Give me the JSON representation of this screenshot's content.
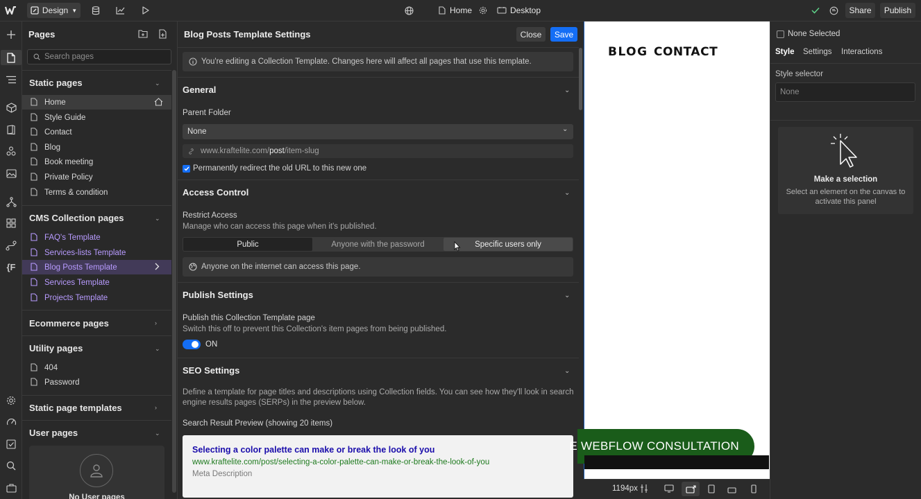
{
  "topbar": {
    "design_label": "Design",
    "page_label": "Home",
    "breakpoint_label": "Desktop",
    "share_label": "Share",
    "publish_label": "Publish"
  },
  "pages_panel": {
    "title": "Pages",
    "search_placeholder": "Search pages",
    "static": {
      "title": "Static pages",
      "items": [
        "Home",
        "Style Guide",
        "Contact",
        "Blog",
        "Book meeting",
        "Private Policy",
        "Terms & condition"
      ]
    },
    "cms": {
      "title": "CMS Collection pages",
      "items": [
        "FAQ's Template",
        "Services-lists Template",
        "Blog Posts Template",
        "Services Template",
        "Projects Template"
      ]
    },
    "ecommerce_title": "Ecommerce pages",
    "utility": {
      "title": "Utility pages",
      "items": [
        "404",
        "Password"
      ]
    },
    "static_templates_title": "Static page templates",
    "user_pages_title": "User pages",
    "no_user_pages": "No User pages"
  },
  "settings": {
    "title": "Blog Posts Template Settings",
    "close_label": "Close",
    "save_label": "Save",
    "notice": "You're editing a Collection Template. Changes here will affect all pages that use this template.",
    "general": {
      "title": "General",
      "parent_folder_label": "Parent Folder",
      "parent_folder_value": "None",
      "url_prefix": "www.kraftelite.com/",
      "url_bold": "post",
      "url_suffix": "/item-slug",
      "redirect_label": "Permanently redirect the old URL to this new one"
    },
    "access": {
      "title": "Access Control",
      "restrict_label": "Restrict Access",
      "restrict_sub": "Manage who can access this page when it's published.",
      "options": [
        "Public",
        "Anyone with the password",
        "Specific users only"
      ],
      "info": "Anyone on the internet can access this page."
    },
    "publish": {
      "title": "Publish Settings",
      "label": "Publish this Collection Template page",
      "sub": "Switch this off to prevent this Collection's item pages from being published.",
      "toggle_label": "ON"
    },
    "seo": {
      "title": "SEO Settings",
      "desc_line1": "Define a template for page titles and descriptions using Collection fields. You can see how they'll look in search",
      "desc_line2": "engine results pages (SERPs) in the preview below.",
      "preview_label": "Search Result Preview (showing 20 items)",
      "result_title": "Selecting a color palette can make or break the look of you",
      "result_url": "www.kraftelite.com/post/selecting-a-color-palette-can-make-or-break-the-look-of-you",
      "result_meta": "Meta Description"
    }
  },
  "canvas": {
    "nav_blog": "BLOG",
    "nav_contact": "CONTACT",
    "cta_text": "E WEBFLOW CONSULTATION",
    "width_label": "1194px"
  },
  "right_panel": {
    "none_selected": "None Selected",
    "tabs": [
      "Style",
      "Settings",
      "Interactions"
    ],
    "style_selector_label": "Style selector",
    "style_selector_placeholder": "None",
    "empty_title": "Make a selection",
    "empty_desc_line1": "Select an element on the canvas to",
    "empty_desc_line2": "activate this panel"
  },
  "colors": {
    "accent": "#146ef5",
    "cms_purple": "#b89bff",
    "cta_green": "#1a5c1a",
    "seo_title_blue": "#1a0dab",
    "seo_url_green": "#1e7a1e"
  }
}
